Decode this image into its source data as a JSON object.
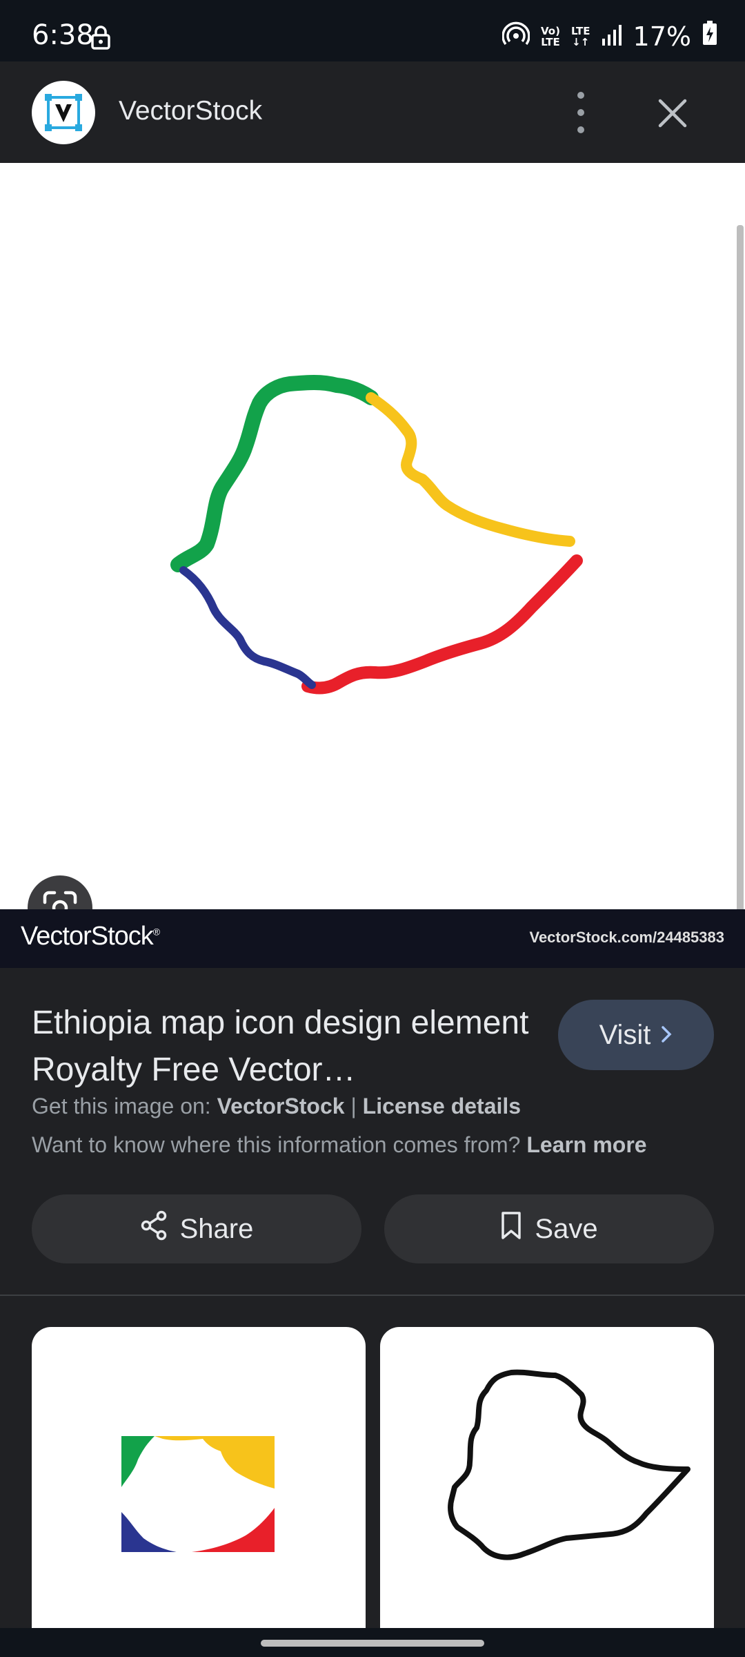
{
  "status_bar": {
    "time": "6:38",
    "net_top": "Vo)",
    "net_bottom": "LTE",
    "lte_top": "LTE",
    "lte_bottom": "↓↑",
    "battery": "17%"
  },
  "header": {
    "site_name": "VectorStock",
    "icons": [
      "lock-icon",
      "hotspot-icon",
      "signal-icon",
      "battery-icon",
      "more-vert-icon",
      "close-icon"
    ]
  },
  "image": {
    "watermark_logo": "VectorStock",
    "watermark_reg": "®",
    "watermark_id": "VectorStock.com/24485383",
    "colors": {
      "green": "#12a24a",
      "yellow": "#f7c31b",
      "red": "#e8202a",
      "blue": "#2a3590"
    }
  },
  "info": {
    "title": "Ethiopia map icon design element Royalty Free Vector…",
    "visit_label": "Visit",
    "source_prefix": "Get this image on:",
    "source_name": "VectorStock",
    "separator": "|",
    "license_label": "License details",
    "learn_prefix": "Want to know where this information comes from?",
    "learn_more": "Learn more",
    "share_label": "Share",
    "save_label": "Save"
  },
  "accent": {
    "visit_bg": "#394457",
    "panel_bg": "#202124"
  }
}
